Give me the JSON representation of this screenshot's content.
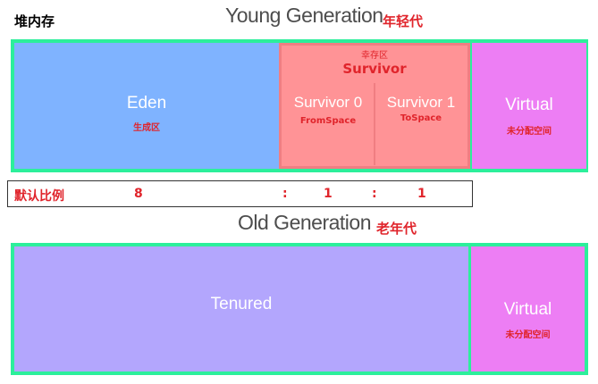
{
  "heap_label": "堆内存",
  "young": {
    "title": "Young Generation",
    "cn": "年轻代",
    "eden": {
      "title": "Eden",
      "sub": "生成区"
    },
    "survivor": {
      "cn": "幸存区",
      "title": "Survivor",
      "s0": {
        "title": "Survivor 0",
        "sub": "FromSpace"
      },
      "s1": {
        "title": "Survivor 1",
        "sub": "ToSpace"
      }
    },
    "virtual": {
      "title": "Virtual",
      "sub": "未分配空间"
    }
  },
  "ratio": {
    "label": "默认比例",
    "eden": "8",
    "sep1": ":",
    "s0": "1",
    "sep2": ":",
    "s1": "1"
  },
  "old": {
    "title": "Old Generation",
    "cn": "老年代",
    "tenured": {
      "title": "Tenured"
    },
    "virtual": {
      "title": "Virtual",
      "sub": "未分配空间"
    }
  },
  "colors": {
    "frame": "#2cef9b",
    "eden": "#7fb3ff",
    "survivor": "#ff9396",
    "virtual": "#ed7ef4",
    "tenured": "#b3a6fd",
    "accent_red": "#e0242b"
  }
}
